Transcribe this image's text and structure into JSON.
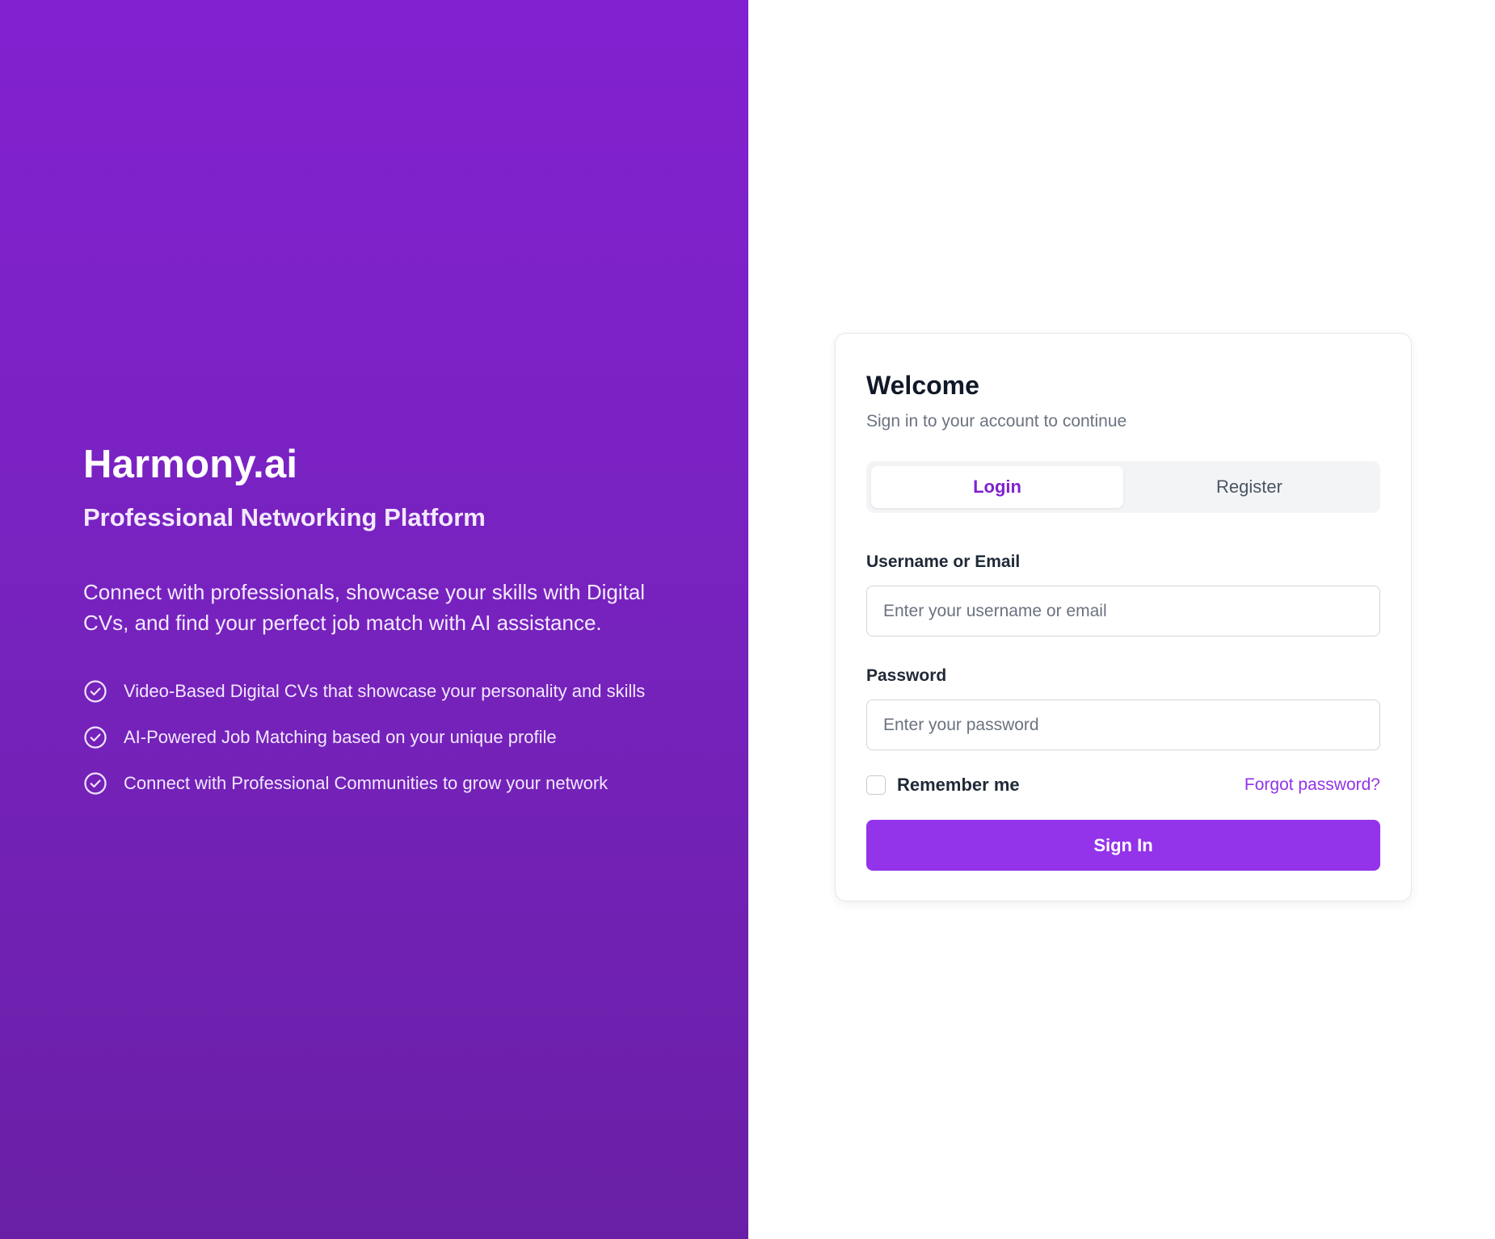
{
  "hero": {
    "brand": "Harmony.ai",
    "tagline": "Professional Networking Platform",
    "description": "Connect with professionals, showcase your skills with Digital CVs, and find your perfect job match with AI assistance.",
    "features": [
      {
        "icon": "check-circle-icon",
        "text": "Video-Based Digital CVs that showcase your personality and skills"
      },
      {
        "icon": "check-circle-icon",
        "text": "AI-Powered Job Matching based on your unique profile"
      },
      {
        "icon": "check-circle-icon",
        "text": "Connect with Professional Communities to grow your network"
      }
    ],
    "gradient_top": "#8221d0",
    "gradient_bottom": "#6a20a6"
  },
  "auth": {
    "title": "Welcome",
    "subtitle": "Sign in to your account to continue",
    "tabs": [
      {
        "label": "Login",
        "active": true
      },
      {
        "label": "Register",
        "active": false
      }
    ],
    "username": {
      "label": "Username or Email",
      "placeholder": "Enter your username or email",
      "value": ""
    },
    "password": {
      "label": "Password",
      "placeholder": "Enter your password",
      "value": ""
    },
    "remember_label": "Remember me",
    "remember_checked": false,
    "forgot_label": "Forgot password?",
    "submit_label": "Sign In",
    "accent_color": "#9333ea"
  }
}
